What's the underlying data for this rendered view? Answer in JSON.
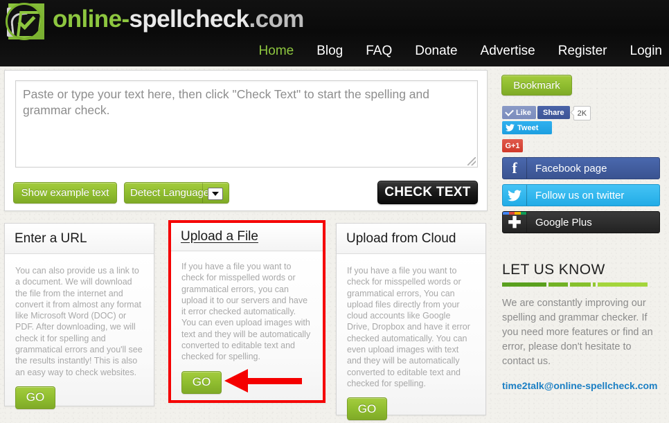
{
  "site": {
    "brand_green": "online",
    "brand_sep": "-",
    "brand_white": "spellcheck",
    "brand_tld": ".com",
    "logo_icon": "checkmark-document-logo"
  },
  "nav": {
    "items": [
      {
        "label": "Home",
        "active": true
      },
      {
        "label": "Blog",
        "active": false
      },
      {
        "label": "FAQ",
        "active": false
      },
      {
        "label": "Donate",
        "active": false
      },
      {
        "label": "Advertise",
        "active": false
      },
      {
        "label": "Register",
        "active": false
      },
      {
        "label": "Login",
        "active": false
      }
    ]
  },
  "editor": {
    "placeholder": "Paste or type your text here, then click \"Check Text\" to start the spelling and grammar check.",
    "value": "",
    "resize_grip_icon": "resize-grip-icon"
  },
  "toolbar": {
    "show_example_label": "Show example text",
    "detect_language_label": "Detect Language",
    "detect_language_caret_icon": "chevron-down-icon",
    "check_text_label": "CHECK TEXT"
  },
  "cards": [
    {
      "title": "Enter a URL",
      "body": "You can also provide us a link to a document. We will download the file from the internet and convert it from almost any format like Microsoft Word (DOC) or PDF. After downloading, we will check it for spelling and grammatical errors and you'll see the results instantly! This is also an easy way to check websites.",
      "go_label": "GO",
      "highlighted": false
    },
    {
      "title": "Upload a File",
      "body": "If you have a file you want to check for misspelled words or grammatical errors, you can upload it to our servers and have it error checked automatically. You can even upload images with text and they will be automatically converted to editable text and checked for spelling.",
      "go_label": "GO",
      "highlighted": true
    },
    {
      "title": "Upload from Cloud",
      "body": "If you have a file you want to check for misspelled words or grammatical errors, You can upload files directly from your cloud accounts like Google Drive, Dropbox and have it error checked automatically. You can even upload images with text and they will be automatically converted to editable text and checked for spelling.",
      "go_label": "GO",
      "highlighted": false
    }
  ],
  "annotation": {
    "arrow_icon": "red-left-arrow-annotation",
    "highlight_color": "#f50000"
  },
  "sidebar": {
    "bookmark_label": "Bookmark",
    "facebook_like_label": "Like",
    "facebook_like_icon": "thumb-check-icon",
    "facebook_share_label": "Share",
    "facebook_share_count": "2K",
    "tweet_label": "Tweet",
    "tweet_icon": "twitter-bird-icon",
    "google_plus_one_label": "G+1",
    "buttons": [
      {
        "label": "Facebook page",
        "icon": "facebook-f-icon"
      },
      {
        "label": "Follow us on twitter",
        "icon": "twitter-bird-icon"
      },
      {
        "label": "Google Plus",
        "icon": "google-plus-icon"
      }
    ],
    "let_us_know": {
      "title": "LET US KNOW",
      "text": "We are constantly improving our spelling and grammar checker. If you need more features or find an error, please don't hesitate to contact us.",
      "email": "time2talk@online-spellcheck.com"
    }
  },
  "colors": {
    "green": "#8dc63f",
    "dark": "#0c0c0c",
    "link_blue": "#1b7fc4",
    "red": "#f50000"
  }
}
